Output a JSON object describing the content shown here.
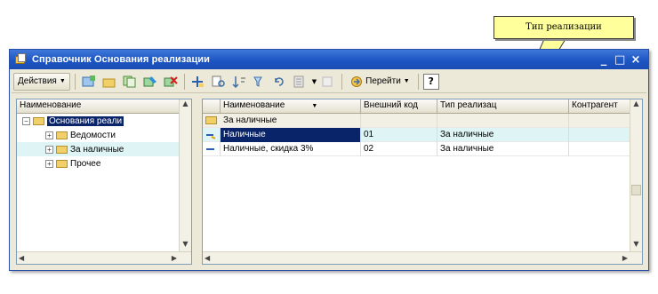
{
  "callout": {
    "text": "Тип реализации"
  },
  "window": {
    "title": "Справочник Основания реализации",
    "controls": {
      "minimize": "_",
      "maximize": "□",
      "close": "×"
    }
  },
  "toolbar": {
    "actions_label": "Действия",
    "goto_label": "Перейти",
    "help_label": "?"
  },
  "tree": {
    "header": "Наименование",
    "items": [
      {
        "label": "Основания реали",
        "level": 0,
        "selected": true
      },
      {
        "label": "Ведомости",
        "level": 1
      },
      {
        "label": "За наличные",
        "level": 1,
        "tinted": true
      },
      {
        "label": "Прочее",
        "level": 1
      }
    ]
  },
  "grid": {
    "columns": [
      "Наименование",
      "Внешний код",
      "Тип реализац",
      "Контрагент"
    ],
    "group_row": "За наличные",
    "rows": [
      {
        "name": "Наличные",
        "code": "01",
        "type": "За наличные",
        "counterparty": "",
        "selected": true
      },
      {
        "name": "Наличные, скидка 3%",
        "code": "02",
        "type": "За наличные",
        "counterparty": ""
      }
    ]
  },
  "colors": {
    "titlebar": "#1d55c4",
    "selection": "#0a246a",
    "row_tint": "#dff4f4",
    "callout_bg": "#ffff9c"
  }
}
